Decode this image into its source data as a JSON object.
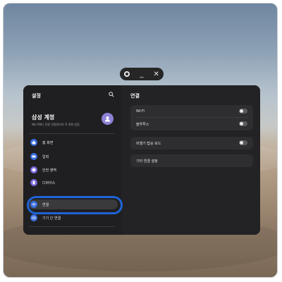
{
  "window_controls": {
    "settings_icon": "gear-icon",
    "minimize_label": "_",
    "close_label": "✕"
  },
  "sidebar": {
    "title": "설정",
    "search_icon": "search-icon",
    "account": {
      "name": "삼성 계정",
      "subtitle": "패드쿠페 | 인원 인원관리자 로 정화 있음",
      "avatar_icon": "person-icon"
    },
    "items": [
      {
        "label": "홈 화면",
        "icon": "home-icon",
        "color": "#3b6fe0"
      },
      {
        "label": "입력",
        "icon": "keyboard-icon",
        "color": "#3b6fe0"
      },
      {
        "label": "안전 영역",
        "icon": "shield-icon",
        "color": "#7a6ae0"
      },
      {
        "label": "디바이스",
        "icon": "device-icon",
        "color": "#7a6ae0"
      },
      {
        "label": "연결",
        "icon": "wifi-icon",
        "color": "#3b6fe0",
        "active": true
      },
      {
        "label": "기기 간 연결",
        "icon": "link-icon",
        "color": "#3b6fe0"
      }
    ]
  },
  "content": {
    "title": "연결",
    "group1": [
      {
        "label": "Wi-Fi",
        "toggle": false
      },
      {
        "label": "블루투스",
        "toggle": false
      }
    ],
    "group2": [
      {
        "label": "비행기 탑승 모드",
        "toggle": false
      }
    ],
    "group3": [
      {
        "label": "기타 연결 설정"
      }
    ]
  },
  "colors": {
    "highlight_ring": "#1f63d6"
  }
}
